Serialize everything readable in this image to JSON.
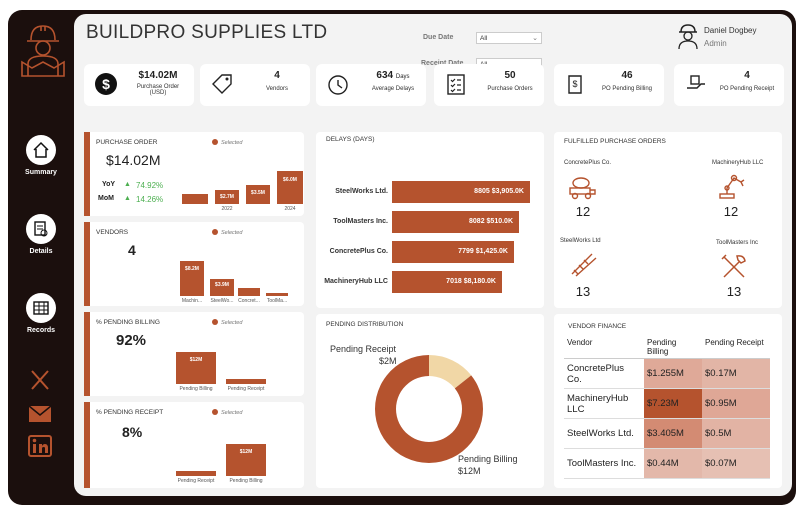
{
  "app": {
    "title": "BUILDPRO SUPPLIES LTD"
  },
  "filters": {
    "due_date_label": "Due Date",
    "due_date_value": "All",
    "receipt_date_label": "Receipt Date",
    "receipt_date_value": "All"
  },
  "user": {
    "name": "Daniel Dogbey",
    "role": "Admin"
  },
  "nav": {
    "summary": "Summary",
    "details": "Details",
    "records": "Records"
  },
  "kpis": {
    "purchase_order": {
      "value": "$14.02M",
      "label": "Purchase Order (USD)"
    },
    "vendors": {
      "value": "4",
      "label": "Vendors"
    },
    "delays": {
      "value": "634",
      "unit": "Days",
      "label": "Average Delays"
    },
    "purchase_orders": {
      "value": "50",
      "label": "Purchase Orders"
    },
    "po_pending_billing": {
      "value": "46",
      "label": "PO Pending Billing"
    },
    "po_pending_receipt": {
      "value": "4",
      "label": "PO Pending Receipt"
    }
  },
  "purchase_order_card": {
    "title": "PURCHASE ORDER",
    "selected": "Selected",
    "value": "$14.02M",
    "yoy_label": "YoY",
    "yoy_value": "74.92%",
    "mom_label": "MoM",
    "mom_value": "14.26%",
    "bar_labels": [
      "$2.7M",
      "$3.5M",
      "$6.0M"
    ],
    "year_labels": [
      "2022",
      "2024"
    ]
  },
  "vendors_card": {
    "title": "VENDORS",
    "selected": "Selected",
    "value": "4",
    "bar_labels": [
      "$8.2M",
      "$3.9M"
    ],
    "categories": [
      "Machin...",
      "SteelWo...",
      "Concret...",
      "ToolMa..."
    ]
  },
  "pending_billing_card": {
    "title": "% PENDING BILLING",
    "selected": "Selected",
    "value": "92%",
    "bar_label": "$12M",
    "categories": [
      "Pending Billing",
      "Pending Receipt"
    ]
  },
  "pending_receipt_card": {
    "title": "% PENDING RECEIPT",
    "selected": "Selected",
    "value": "8%",
    "bar_label": "$12M",
    "categories": [
      "Pending Receipt",
      "Pending Billing"
    ]
  },
  "delays_card": {
    "title": "DELAYS (DAYS)"
  },
  "pending_distribution": {
    "title": "PENDING DISTRIBUTION",
    "receipt_label": "Pending Receipt",
    "receipt_value": "$2M",
    "billing_label": "Pending Billing",
    "billing_value": "$12M"
  },
  "fulfilled": {
    "title": "FULFILLED PURCHASE ORDERS",
    "items": [
      {
        "name": "ConcretePlus Co.",
        "value": "12"
      },
      {
        "name": "MachineryHub LLC",
        "value": "12"
      },
      {
        "name": "SteelWorks Ltd",
        "value": "13"
      },
      {
        "name": "ToolMasters Inc",
        "value": "13"
      }
    ]
  },
  "vendor_finance": {
    "title": "VENDOR FINANCE",
    "headers": [
      "Vendor",
      "Pending Billing",
      "Pending Receipt"
    ],
    "rows": [
      {
        "vendor": "ConcretePlus Co.",
        "billing": "$1.255M",
        "receipt": "$0.17M"
      },
      {
        "vendor": "MachineryHub LLC",
        "billing": "$7.23M",
        "receipt": "$0.95M"
      },
      {
        "vendor": "SteelWorks Ltd.",
        "billing": "$3.405M",
        "receipt": "$0.5M"
      },
      {
        "vendor": "ToolMasters Inc.",
        "billing": "$0.44M",
        "receipt": "$0.07M"
      }
    ]
  },
  "colors": {
    "accent": "#b5532e",
    "frame": "#1b0f0d",
    "donut_light": "#f1d7a6"
  },
  "chart_data": [
    {
      "type": "bar",
      "title": "DELAYS (DAYS)",
      "orientation": "horizontal",
      "categories": [
        "SteelWorks Ltd.",
        "ToolMasters Inc.",
        "ConcretePlus Co.",
        "MachineryHub LLC"
      ],
      "values": [
        8805,
        8082,
        7799,
        7018
      ],
      "labels": [
        "8805 $3,905.0K",
        "8082 $510.0K",
        "7799 $1,425.0K",
        "7018 $8,180.0K"
      ]
    },
    {
      "type": "pie",
      "title": "PENDING DISTRIBUTION",
      "categories": [
        "Pending Receipt",
        "Pending Billing"
      ],
      "values": [
        2,
        12
      ],
      "labels": [
        "$2M",
        "$12M"
      ]
    }
  ]
}
